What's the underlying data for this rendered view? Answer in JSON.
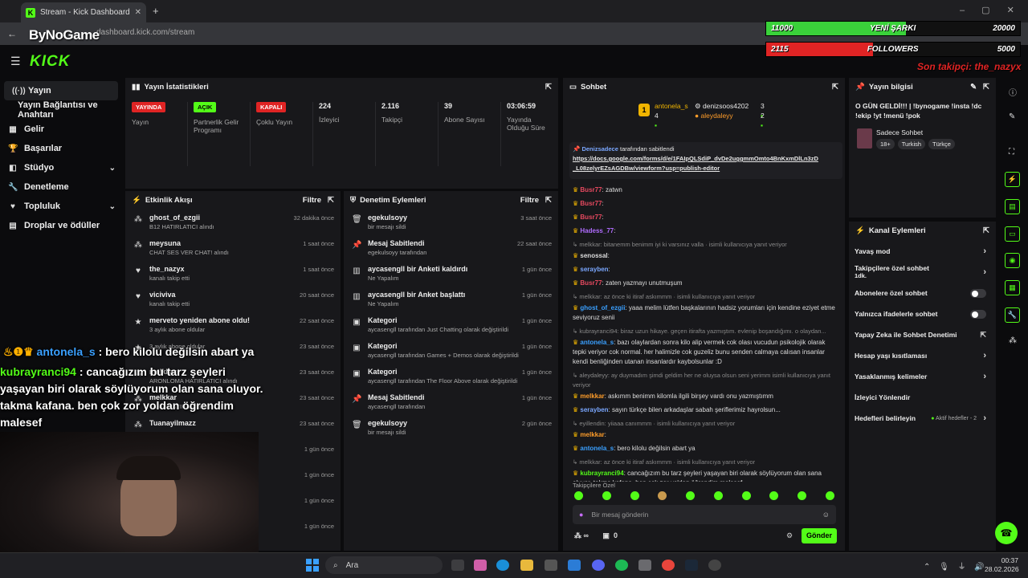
{
  "browser": {
    "tab_title": "Stream - Kick Dashboard",
    "url": "dashboard.kick.com/stream",
    "new_tab": "+"
  },
  "overlay": {
    "channel_watermark": "ByNoGame",
    "goal1": {
      "left": "11000",
      "label": "YENİ ŞARKI",
      "right": "20000",
      "color": "#3ad13a",
      "progress": 0.55
    },
    "goal2": {
      "left": "2115",
      "label": "FOLLOWERS",
      "right": "5000",
      "color": "#e02424",
      "progress": 0.42
    },
    "last_follower": "Son takipçi: the_nazyx",
    "chat": [
      {
        "user": "antonela_s",
        "text": " : bero kilolu değilsin abart ya"
      },
      {
        "user": "kubrayranci94",
        "text": " : cancağızım bu tarz şeyleri"
      },
      {
        "user": "",
        "text": "yaşayan biri olarak söylüyorum olan sana oluyor."
      },
      {
        "user": "",
        "text": "takma kafana. ben çok zor yoldan öğrendim"
      },
      {
        "user": "",
        "text": "malesef"
      }
    ]
  },
  "kick": {
    "logo": "KICK"
  },
  "sidebar": {
    "items": [
      {
        "label": "Yayın",
        "icon": "broadcast-icon"
      },
      {
        "label": "Yayın Bağlantısı ve Anahtarı",
        "icon": ""
      },
      {
        "label": "Gelir",
        "icon": "revenue-icon"
      },
      {
        "label": "Başarılar",
        "icon": "trophy-icon"
      },
      {
        "label": "Stüdyo",
        "icon": "studio-icon"
      },
      {
        "label": "Denetleme",
        "icon": "wrench-icon"
      },
      {
        "label": "Topluluk",
        "icon": "community-icon"
      },
      {
        "label": "Droplar ve ödüller",
        "icon": "drops-icon"
      }
    ]
  },
  "stats": {
    "title": "Yayın İstatistikleri",
    "items": [
      {
        "badge": "YAYINDA",
        "badge_color": "#e02424",
        "label": "Yayın"
      },
      {
        "badge": "AÇIK",
        "badge_color": "#53fc18",
        "label": "Partnerlik Gelir Programı"
      },
      {
        "badge": "KAPALI",
        "badge_color": "#e02424",
        "label": "Çoklu Yayın"
      },
      {
        "value": "224",
        "label": "İzleyici"
      },
      {
        "value": "2.116",
        "label": "Takipçi"
      },
      {
        "value": "39",
        "label": "Abone Sayısı"
      },
      {
        "value": "03:06:59",
        "label": "Yayında Olduğu Süre"
      }
    ]
  },
  "activity": {
    "title": "Etkinlik Akışı",
    "filter": "Filtre",
    "rows": [
      {
        "title": "ghost_of_ezgii",
        "sub": "B12 HATIRLATICI alındı",
        "time": "32 dakika önce"
      },
      {
        "title": "meysuna",
        "sub": "CHAT SES VER CHAT! alındı",
        "time": "1 saat önce"
      },
      {
        "title": "the_nazyx",
        "sub": "kanalı takip etti",
        "time": "1 saat önce"
      },
      {
        "title": "viciviva",
        "sub": "kanalı takip etti",
        "time": "20 saat önce"
      },
      {
        "title": "merveto yeniden abone oldu!",
        "sub": "3 aylık abone oldular",
        "time": "22 saat önce"
      },
      {
        "title": "",
        "sub": "3 aylık abone oldular",
        "time": "23 saat önce"
      },
      {
        "title": "melkkar",
        "sub": "ARONLOMA HATIRLATICI alındı",
        "time": "23 saat önce"
      },
      {
        "title": "melkkar",
        "sub": "TARIF HATIRLAT alındı",
        "time": "23 saat önce"
      },
      {
        "title": "Tuanayilmazz",
        "sub": "",
        "time": "23 saat önce"
      },
      {
        "title": "",
        "sub": "",
        "time": "1 gün önce"
      },
      {
        "title": "",
        "sub": "",
        "time": "1 gün önce"
      },
      {
        "title": "",
        "sub": "",
        "time": "1 gün önce"
      },
      {
        "title": "",
        "sub": "",
        "time": "1 gün önce"
      }
    ]
  },
  "moderation": {
    "title": "Denetim Eylemleri",
    "filter": "Filtre",
    "rows": [
      {
        "icon": "trash-icon",
        "title": "egekulsoyy",
        "sub": "bir mesajı sildi",
        "time": "3 saat önce"
      },
      {
        "icon": "pin-icon",
        "title": "Mesaj Sabitlendi",
        "sub": "egekulsoyy tarafından",
        "time": "22 saat önce"
      },
      {
        "icon": "poll-icon",
        "title": "aycasengll bir Anketi kaldırdı",
        "sub": "Ne Yapalım",
        "time": "1 gün önce"
      },
      {
        "icon": "poll-icon",
        "title": "aycasengll bir Anket başlattı",
        "sub": "Ne Yapalım",
        "time": "1 gün önce"
      },
      {
        "icon": "category-icon",
        "title": "Kategori",
        "sub": "aycasengll tarafından Just Chatting olarak değiştirildi",
        "time": "1 gün önce"
      },
      {
        "icon": "category-icon",
        "title": "Kategori",
        "sub": "aycasengll tarafından Games + Demos olarak değiştirildi",
        "time": "1 gün önce"
      },
      {
        "icon": "category-icon",
        "title": "Kategori",
        "sub": "aycasengll tarafından The Floor Above olarak değiştirildi",
        "time": "1 gün önce"
      },
      {
        "icon": "pin-icon",
        "title": "Mesaj Sabitlendi",
        "sub": "aycasengll tarafından",
        "time": "1 gün önce"
      },
      {
        "icon": "trash-icon",
        "title": "egekulsoyy",
        "sub": "bir mesajı sildi",
        "time": "2 gün önce"
      }
    ]
  },
  "chat": {
    "title": "Sohbet",
    "leaders": [
      {
        "name": "antonela_s",
        "count": "4"
      },
      {
        "name": "denizsoos4202",
        "count": "3"
      },
      {
        "name": "aleydaleyy",
        "count": "2"
      }
    ],
    "pinned": {
      "by": "Denizsadece",
      "label": "tarafından sabitlendi",
      "link": "https://docs.google.com/forms/d/e/1FAIpQLSdiP_dvDe2uggmmOmto4BnKxmDlLn3zD_L08zelyrEZsAGDBw/viewform?usp=publish-editor"
    },
    "messages": [
      {
        "sys": false,
        "user": "Busr77",
        "color": "#e6495f",
        "text": ": zatwn"
      },
      {
        "sys": false,
        "user": "Busr77",
        "color": "#e6495f",
        "text": ": "
      },
      {
        "sys": false,
        "user": "Busr77",
        "color": "#e6495f",
        "text": ": "
      },
      {
        "sys": false,
        "user": "Hadess_77",
        "color": "#b06cff",
        "text": ": "
      },
      {
        "sys": true,
        "user": "",
        "color": "",
        "text": "melkkar: bitanemm benimm iyi ki varsınız valla · isimli kullanıcıya yanıt veriyor"
      },
      {
        "sys": false,
        "user": "senossal",
        "color": "#dddddd",
        "text": ": "
      },
      {
        "sys": false,
        "user": "serayben",
        "color": "#7aa7ff",
        "text": ": "
      },
      {
        "sys": false,
        "user": "Busr77",
        "color": "#e6495f",
        "text": ": zaten yazmayı unutmuşum"
      },
      {
        "sys": true,
        "user": "",
        "color": "",
        "text": "melkkar: az önce ki itiraf askımmm · isimli kullanıcıya yanıt veriyor"
      },
      {
        "sys": false,
        "user": "ghost_of_ezgii",
        "color": "#3aa0ff",
        "text": ": yaaa melim lütfen başkalarının hadsiz yorumları için kendine eziyet etme seviyoruz senii"
      },
      {
        "sys": true,
        "user": "",
        "color": "",
        "text": "kubrayranci94: biraz uzun hikaye. geçen itirafta yazmıştım. evlenip boşandığımı. o olaydan..."
      },
      {
        "sys": false,
        "user": "antonela_s",
        "color": "#3aa0ff",
        "text": ": bazı olaylardan sonra kilo alip vermek cok olası vucudun psikolojik olarak tepki veriyor cok normal. her halimizle cok guzeliz bunu senden calmaya calısan insanlar kendi benliğinden utanan insanlardır kaybolsunlar :D"
      },
      {
        "sys": true,
        "user": "",
        "color": "",
        "text": "aleydaleyy: ay duymadım şimdi geldim her ne oluysa olsun seni yerimm isimli kullanıcıya yanıt veriyor"
      },
      {
        "sys": false,
        "user": "melkkar",
        "color": "#ff9d2a",
        "text": ": askımm benimm kilomla ilgili birşey vardı onu yazmıştımm"
      },
      {
        "sys": false,
        "user": "serayben",
        "color": "#7aa7ff",
        "text": ": sayın türkçe bilen arkadaşlar sabah şeriflerimiz hayrolsun..."
      },
      {
        "sys": true,
        "user": "",
        "color": "",
        "text": "eyillendin: yiiaaa canımmm · isimli kullanıcıya yanıt veriyor"
      },
      {
        "sys": false,
        "user": "melkkar",
        "color": "#ff9d2a",
        "text": ": "
      },
      {
        "sys": false,
        "user": "antonela_s",
        "color": "#3aa0ff",
        "text": ": bero kilolu değilsin abart ya"
      },
      {
        "sys": true,
        "user": "",
        "color": "",
        "text": "melkkar: az önce ki itiraf askımmm · isimli kullanıcıya yanıt veriyor"
      },
      {
        "sys": false,
        "user": "kubrayranci94",
        "color": "#53fc18",
        "text": ": cancağızım bu tarz şeyleri yaşayan biri olarak söylüyorum olan sana oluyor. takma kafana. ben çok zor yoldan öğrendim malesef"
      }
    ],
    "emote_label": "Takipçilere Özel",
    "input_placeholder": "Bir mesaj gönderin",
    "points": "0",
    "send": "Gönder"
  },
  "stream_info": {
    "title": "Yayın bilgisi",
    "text": "O GÜN GELDİ!!! | !bynogame !insta !dc !ekip !yt !menü !pok",
    "category": "Sadece Sohbet",
    "tags": [
      "18+",
      "Turkish",
      "Türkçe"
    ]
  },
  "channel_actions": {
    "title": "Kanal Eylemleri",
    "rows": [
      {
        "label": "Yavaş mod",
        "action": "chevron",
        "extra": ""
      },
      {
        "label": "Takipçilere özel sohbet",
        "action": "chevron",
        "extra": "1dk."
      },
      {
        "label": "Abonelere özel sohbet",
        "action": "toggle",
        "extra": ""
      },
      {
        "label": "Yalnızca ifadelerle sohbet",
        "action": "toggle",
        "extra": ""
      },
      {
        "label": "Yapay Zeka ile Sohbet Denetimi",
        "action": "external",
        "extra": ""
      },
      {
        "label": "Hesap yaşı kısıtlaması",
        "action": "chevron",
        "extra": ""
      },
      {
        "label": "Yasaklanmış kelimeler",
        "action": "chevron",
        "extra": ""
      },
      {
        "label": "İzleyici Yönlendir",
        "action": "none",
        "extra": ""
      },
      {
        "label": "Hedefleri belirleyin",
        "action": "chevron",
        "extra": "Aktif hedefler - 2"
      }
    ]
  },
  "taskbar": {
    "search": "Ara",
    "time": "00:37",
    "date": "28.02.2026"
  }
}
